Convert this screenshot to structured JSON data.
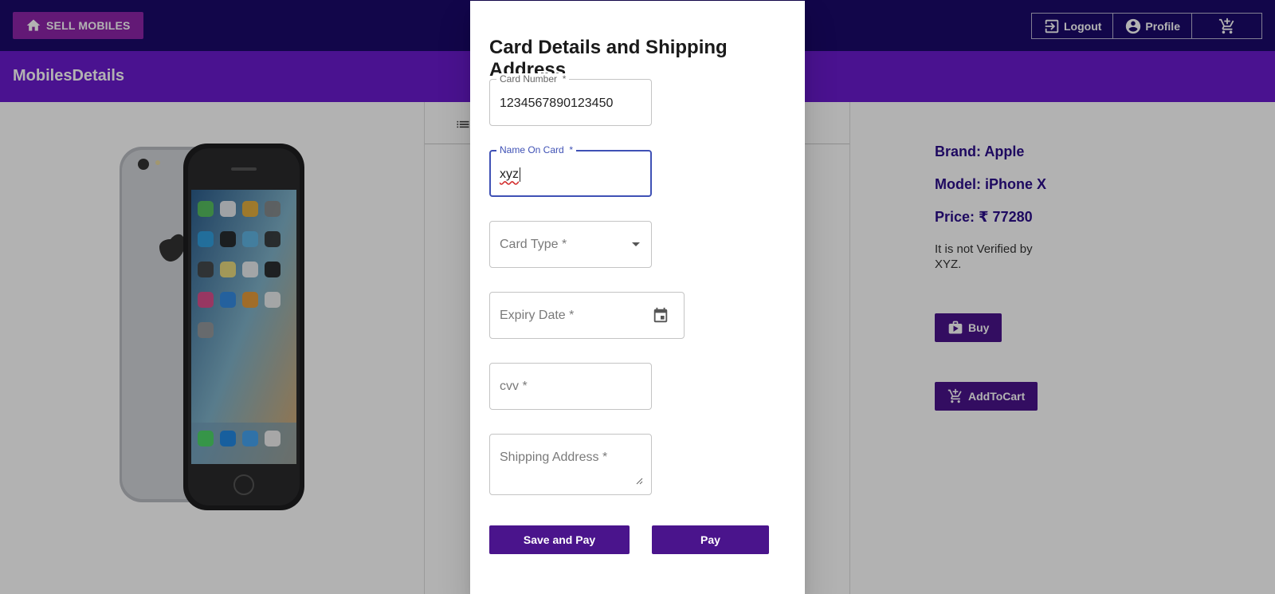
{
  "appbar": {
    "home_label": "SELL MOBILES",
    "logout_label": "Logout",
    "profile_label": "Profile"
  },
  "subbar": {
    "title": "MobilesDetails"
  },
  "details": {
    "brand": "Brand: Apple",
    "model": "Model: iPhone X",
    "price": "Price: ₹ 77280",
    "note": "It is not Verified by XYZ.",
    "buy_label": "Buy",
    "add_to_cart_label": "AddToCart"
  },
  "dialog": {
    "title": "Card Details and Shipping Address",
    "card_number": {
      "label": "Card Number",
      "required": "*",
      "value": "1234567890123450"
    },
    "name_on_card": {
      "label": "Name On Card",
      "required": "*",
      "value": "xyz"
    },
    "card_type": {
      "placeholder": "Card Type  *"
    },
    "expiry_date": {
      "placeholder": "Expiry Date  *"
    },
    "cvv": {
      "placeholder": "cvv  *"
    },
    "shipping_address": {
      "placeholder": "Shipping Address  *"
    },
    "save_and_pay_label": "Save and Pay",
    "pay_label": "Pay"
  },
  "colors": {
    "appbar": "#1b0a6b",
    "subbar": "#6a1bcf",
    "accent_button": "#4a148c",
    "home_button": "#8e24aa",
    "focus": "#3f51b5"
  }
}
